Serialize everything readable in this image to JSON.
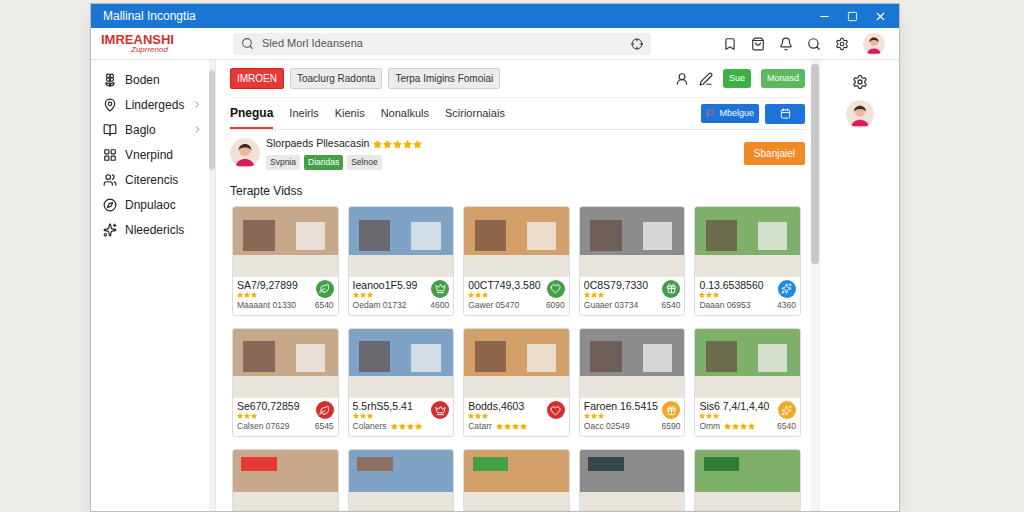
{
  "window": {
    "title": "Mallinal Incongtia"
  },
  "header": {
    "logo": "IMREANSHI",
    "logo_sub": "Zuprrenod"
  },
  "search": {
    "placeholder": "Sled Morl Ideansena"
  },
  "sidebar": {
    "items": [
      {
        "label": "Boden",
        "expandable": false
      },
      {
        "label": "Lindergeds",
        "expandable": true
      },
      {
        "label": "Baglo",
        "expandable": true
      },
      {
        "label": "Vnerpind",
        "expandable": false
      },
      {
        "label": "Citerencis",
        "expandable": false
      },
      {
        "label": "Dnpulaoc",
        "expandable": false
      },
      {
        "label": "Nleedericls",
        "expandable": false
      }
    ]
  },
  "toolbar": {
    "tabs": [
      {
        "label": "IMROEN",
        "selected": true
      },
      {
        "label": "Toaclurg Radonta",
        "selected": false
      },
      {
        "label": "Terpa Imigins Fomoiai",
        "selected": false
      }
    ],
    "buttons": [
      "Sue",
      "Monasd"
    ]
  },
  "subtabs": {
    "items": [
      {
        "label": "Pnegua",
        "selected": true
      },
      {
        "label": "Ineirls",
        "selected": false
      },
      {
        "label": "Kienis",
        "selected": false
      },
      {
        "label": "Nonalkuls",
        "selected": false
      },
      {
        "label": "Sciriornaiais",
        "selected": false
      }
    ],
    "button": "Mbelgue"
  },
  "profile": {
    "name": "Slorpaeds Pllesacasin",
    "stars": 5,
    "chips": [
      {
        "label": "Svpnia",
        "color": "#e8e8e8"
      },
      {
        "label": "Diaridas",
        "color": "#43a047"
      },
      {
        "label": "Selnoe",
        "color": "#e8e8e8"
      }
    ],
    "action": "Sbanjaiel"
  },
  "section": {
    "title": "Terapte Vidss"
  },
  "cards": [
    {
      "kind": "full",
      "title": "SA7/9,27899",
      "stars": 3,
      "caption": "Maaaant 01330",
      "value": "6540",
      "color": "#43a047"
    },
    {
      "kind": "full",
      "title": "Ieanoo1F5.99",
      "stars": 3,
      "caption": "Oedam 01732",
      "value": "4600",
      "color": "#43a047"
    },
    {
      "kind": "full",
      "title": "00CT749,3.580",
      "stars": 3,
      "caption": "Gawer 05470",
      "value": "6090",
      "color": "#43a047"
    },
    {
      "kind": "full",
      "title": "0C8S79,7330",
      "stars": 3,
      "caption": "Guaaer 03734",
      "value": "6540",
      "color": "#43a047"
    },
    {
      "kind": "full",
      "title": "0.13.6538560",
      "stars": 3,
      "caption": "Daaan 06953",
      "value": "4360",
      "color": "#1e88e5"
    },
    {
      "kind": "full",
      "title": "Se670,72859",
      "stars": 3,
      "caption": "Calsen 07629",
      "value": "6545",
      "color": "#d32f2f"
    },
    {
      "kind": "full",
      "title": "5.5rhS5,5.41",
      "stars": 3,
      "caption": "Colaners",
      "caption_stars": 4,
      "color": "#d32f2f"
    },
    {
      "kind": "full",
      "title": "Bodds,4603",
      "stars": 3,
      "caption": "Catarr",
      "caption_stars": 4,
      "color": "#d32f2f"
    },
    {
      "kind": "full",
      "title": "Faroen 16.5415",
      "stars": 3,
      "caption": "Oacc 02549",
      "value": "6590",
      "color": "#f5a623"
    },
    {
      "kind": "full",
      "title": "Sis6 7,4/1,4,40",
      "stars": 3,
      "caption": "Omm",
      "caption_stars": 4,
      "value": "6540",
      "color": "#f5a623"
    },
    {
      "kind": "photo",
      "color": "#e53935"
    },
    {
      "kind": "photo",
      "color": "#8d6e63"
    },
    {
      "kind": "photo",
      "color": "#43a047"
    },
    {
      "kind": "photo",
      "color": "#37474f"
    },
    {
      "kind": "photo",
      "color": "#2e7d32"
    }
  ]
}
